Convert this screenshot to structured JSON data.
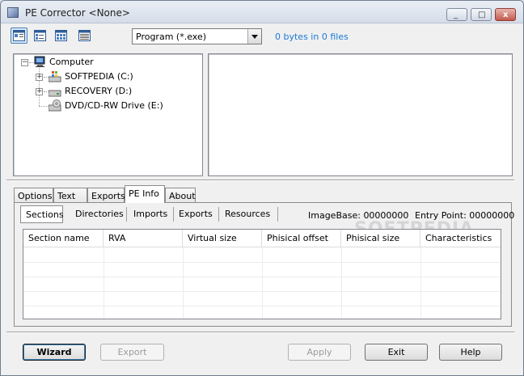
{
  "window": {
    "title": "PE Corrector <None>",
    "accent": "#1a7ad4"
  },
  "caption_buttons": {
    "minimize": "minimize-icon",
    "maximize": "maximize-icon",
    "close": "close-icon"
  },
  "toolbar": {
    "view_buttons": [
      "view-large-icons-icon",
      "view-details-icon",
      "view-grid-icon",
      "view-list-icon"
    ],
    "filter_value": "Program (*.exe)",
    "status": "0 bytes in 0 files"
  },
  "tree": {
    "root": "Computer",
    "items": [
      {
        "label": "SOFTPEDIA (C:)"
      },
      {
        "label": "RECOVERY (D:)"
      },
      {
        "label": "DVD/CD-RW Drive (E:)"
      }
    ]
  },
  "tabs": [
    "Options",
    "Text",
    "Exports",
    "PE Info",
    "About"
  ],
  "selected_tab": "PE Info",
  "subtabs": [
    "Sections",
    "Directories",
    "Imports",
    "Exports",
    "Resources"
  ],
  "selected_subtab": "Sections",
  "info": {
    "image_base": "ImageBase: 00000000",
    "entry_point": "Entry Point: 00000000"
  },
  "table": {
    "columns": [
      "Section name",
      "RVA",
      "Virtual size",
      "Phisical offset",
      "Phisical size",
      "Characteristics"
    ],
    "rows": []
  },
  "watermark": "SOFTPEDIA",
  "buttons": {
    "wizard": "Wizard",
    "export": "Export",
    "apply": "Apply",
    "exit": "Exit",
    "help": "Help"
  }
}
